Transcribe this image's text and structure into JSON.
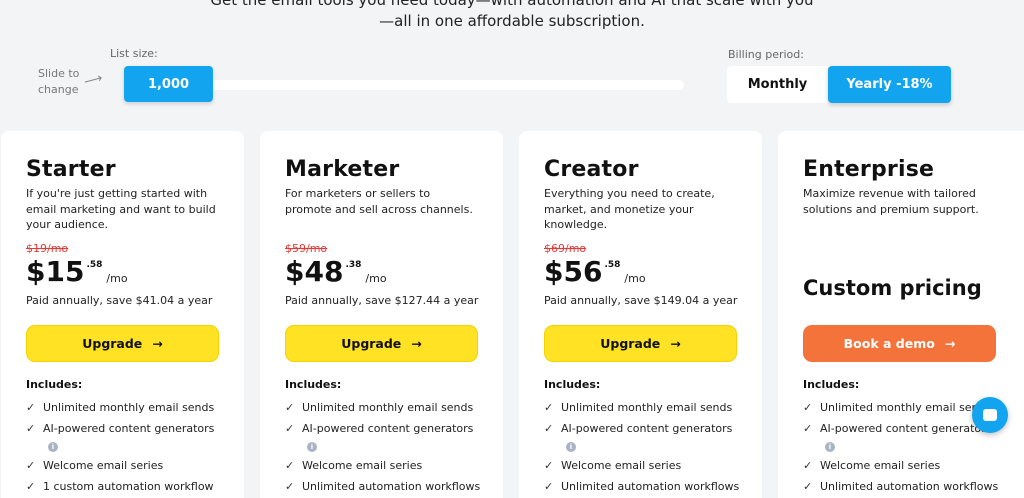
{
  "hero": {
    "line1": "Get the email tools you need today—with automation and AI that scale with you",
    "line2": "—all in one affordable subscription."
  },
  "list_size": {
    "label": "List size:",
    "hint_line1": "Slide to",
    "hint_line2": "change",
    "value": "1,000"
  },
  "billing": {
    "label": "Billing period:",
    "monthly": "Monthly",
    "yearly": "Yearly -18%",
    "selected": "Yearly -18%"
  },
  "includes_label": "Includes:",
  "plans": [
    {
      "name": "Starter",
      "desc": "If you're just getting started with email marketing and want to build your audience.",
      "old_price": "$19/mo",
      "price_main": "$15",
      "price_cents": ".58",
      "price_unit": "/mo",
      "save": "Paid annually, save $41.04 a year",
      "cta": "Upgrade",
      "features": [
        "Unlimited monthly email sends",
        "AI-powered content generators",
        "Welcome email series",
        "1 custom automation workflow"
      ]
    },
    {
      "name": "Marketer",
      "desc": "For marketers or sellers to promote and sell across channels.",
      "old_price": "$59/mo",
      "price_main": "$48",
      "price_cents": ".38",
      "price_unit": "/mo",
      "save": "Paid annually, save $127.44 a year",
      "cta": "Upgrade",
      "features": [
        "Unlimited monthly email sends",
        "AI-powered content generators",
        "Welcome email series",
        "Unlimited automation workflows"
      ]
    },
    {
      "name": "Creator",
      "desc": "Everything you need to create, market, and monetize your knowledge.",
      "old_price": "$69/mo",
      "price_main": "$56",
      "price_cents": ".58",
      "price_unit": "/mo",
      "save": "Paid annually, save $149.04 a year",
      "cta": "Upgrade",
      "features": [
        "Unlimited monthly email sends",
        "AI-powered content generators",
        "Welcome email series",
        "Unlimited automation workflows"
      ]
    },
    {
      "name": "Enterprise",
      "desc": "Maximize revenue with tailored solutions and premium support.",
      "custom_price": "Custom pricing",
      "cta": "Book a demo",
      "features": [
        "Unlimited monthly email sends",
        "AI-powered content generators",
        "Welcome email series",
        "Unlimited automation workflows"
      ]
    }
  ],
  "colors": {
    "accent_blue": "#12a4ef",
    "cta_yellow": "#ffe224",
    "cta_orange": "#f4733b",
    "strike_red": "#e53935"
  },
  "icons": {
    "checkmark": "check-icon",
    "info": "info-icon",
    "arrow": "arrow-right-icon",
    "chat": "chat-icon"
  }
}
